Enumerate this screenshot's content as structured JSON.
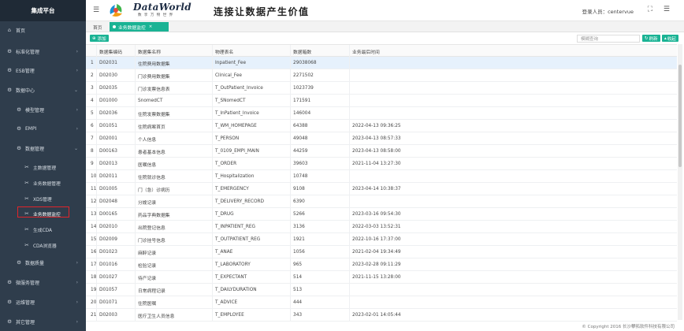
{
  "sidebar": {
    "brand": "集成平台",
    "items": [
      {
        "label": "首页",
        "icon": "home-icon",
        "chevron": ""
      },
      {
        "label": "标准化管理",
        "icon": "gear-icon",
        "chevron": "›"
      },
      {
        "label": "ESB管理",
        "icon": "gear-icon",
        "chevron": "›"
      },
      {
        "label": "数据中心",
        "icon": "gear-icon",
        "chevron": "⌄"
      },
      {
        "label": "模型管理",
        "icon": "gear-icon",
        "chevron": "›"
      },
      {
        "label": "EMPI",
        "icon": "gear-icon",
        "chevron": "›"
      },
      {
        "label": "数据管理",
        "icon": "gear-icon",
        "chevron": "⌄"
      },
      {
        "label": "主数据管理",
        "icon": "tools-icon",
        "chevron": ""
      },
      {
        "label": "业务数据管理",
        "icon": "tools-icon",
        "chevron": ""
      },
      {
        "label": "XDS管理",
        "icon": "tools-icon",
        "chevron": ""
      },
      {
        "label": "业务数据监控",
        "icon": "tools-icon",
        "chevron": ""
      },
      {
        "label": "生成CDA",
        "icon": "tools-icon",
        "chevron": ""
      },
      {
        "label": "CDA浏览器",
        "icon": "tools-icon",
        "chevron": ""
      },
      {
        "label": "数据质量",
        "icon": "gear-icon",
        "chevron": "›"
      },
      {
        "label": "微服务管理",
        "icon": "gear-icon",
        "chevron": "›"
      },
      {
        "label": "运维管理",
        "icon": "gear-icon",
        "chevron": "›"
      },
      {
        "label": "其它管理",
        "icon": "gear-icon",
        "chevron": "›"
      }
    ]
  },
  "header": {
    "logo_title": "DataWorld",
    "logo_subtitle": "数 享 万 物 世 界",
    "slogan": "连接让数据产生价值",
    "user_label": "登录人员：centervue",
    "expand_icon": "⛶",
    "menu_icon": "☰"
  },
  "tabs": {
    "home": "首页",
    "active": "业务数据监控",
    "close": "×"
  },
  "toolbar": {
    "add": "添加",
    "search_placeholder": "模糊查询",
    "refresh": "刷新",
    "collapse": "收起"
  },
  "table": {
    "columns": [
      "",
      "数据集编码",
      "数据集名称",
      "物理表名",
      "数据箱数",
      "业务最后时间"
    ],
    "rows": [
      [
        "1",
        "D02031",
        "住院费用数据集",
        "Inpatient_Fee",
        "29038068",
        ""
      ],
      [
        "2",
        "D02030",
        "门诊费用数据集",
        "Clinical_Fee",
        "2271502",
        ""
      ],
      [
        "3",
        "D02035",
        "门诊发票信息表",
        "T_OutPatient_Invoice",
        "1023739",
        ""
      ],
      [
        "4",
        "D01000",
        "SnomedCT",
        "T_SNomedCT",
        "171591",
        ""
      ],
      [
        "5",
        "D02036",
        "住院发票数据集",
        "T_InPatient_Invoice",
        "146004",
        ""
      ],
      [
        "6",
        "D01051",
        "住院病案首页",
        "T_WM_HOMEPAGE",
        "64388",
        "2022-04-13 09:36:25"
      ],
      [
        "7",
        "D02001",
        "个人信息",
        "T_PERSON",
        "49048",
        "2023-04-13 08:57:33"
      ],
      [
        "8",
        "D00163",
        "患者基本信息",
        "T_0109_EMPI_MAIN",
        "44259",
        "2023-04-13 08:58:00"
      ],
      [
        "9",
        "D02013",
        "医嘱信息",
        "T_ORDER",
        "39603",
        "2021-11-04 13:27:30"
      ],
      [
        "10",
        "D02011",
        "住院就诊信息",
        "T_Hospitalization",
        "10748",
        ""
      ],
      [
        "11",
        "D01005",
        "门（急）诊病历",
        "T_EMERGENCY",
        "9108",
        "2023-04-14 10:38:37"
      ],
      [
        "12",
        "D02048",
        "分娩记录",
        "T_DELIVERY_RECORD",
        "6390",
        ""
      ],
      [
        "13",
        "D00165",
        "药品字典数据集",
        "T_DRUG",
        "5266",
        "2023-03-16 09:54:30"
      ],
      [
        "14",
        "D02010",
        "出院登记信息",
        "T_INPATIENT_REG",
        "3136",
        "2022-03-03 13:52:31"
      ],
      [
        "15",
        "D02009",
        "门诊挂号信息",
        "T_OUTPATIENT_REG",
        "1921",
        "2022-10-16 17:37:00"
      ],
      [
        "16",
        "D01023",
        "麻醉记录",
        "T_ANAE",
        "1056",
        "2021-02-04 19:34:49"
      ],
      [
        "17",
        "D01016",
        "检验记录",
        "T_LABORATORY",
        "965",
        "2023-02-28 09:11:29"
      ],
      [
        "18",
        "D01027",
        "待产记录",
        "T_EXPECTANT",
        "514",
        "2021-11-15 13:28:00"
      ],
      [
        "19",
        "D01057",
        "日常病程记录",
        "T_DAILYDURATION",
        "513",
        ""
      ],
      [
        "20",
        "D01071",
        "住院医嘱",
        "T_ADVICE",
        "444",
        ""
      ],
      [
        "21",
        "D02003",
        "医疗卫生人员信息",
        "T_EMPLOYEE",
        "343",
        "2023-02-01 14:05:44"
      ]
    ],
    "highlight_row": 0
  },
  "footer": "© Copyright 2016 长沙攀拓软件科技有限公司",
  "colors": {
    "sidebar": "#2f3d4c",
    "accent": "#1ab394",
    "active_outline": "#e0242a",
    "row_highlight": "#e6f1fc"
  }
}
